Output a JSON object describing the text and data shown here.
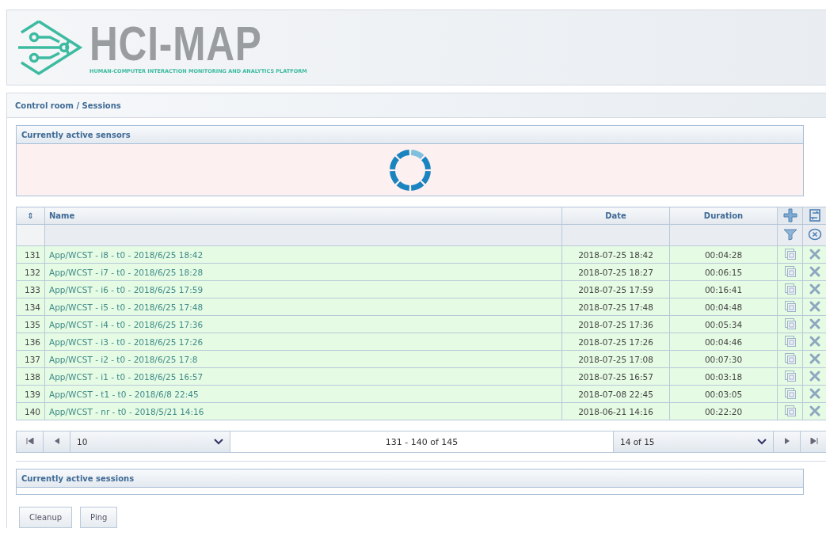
{
  "header": {
    "logo_title": "HCI-MAP",
    "logo_subtitle": "HUMAN-COMPUTER INTERACTION MONITORING AND ANALYTICS PLATFORM"
  },
  "breadcrumb": "Control room / Sessions",
  "sensors_panel": {
    "title": "Currently active sensors",
    "loading": true
  },
  "table": {
    "sort_icon": "⇕",
    "columns": [
      "Name",
      "Date",
      "Duration"
    ],
    "rows": [
      {
        "index": "131",
        "name": "App/WCST - i8 - t0 - 2018/6/25 18:42",
        "date": "2018-07-25 18:42",
        "duration": "00:04:28"
      },
      {
        "index": "132",
        "name": "App/WCST - i7 - t0 - 2018/6/25 18:28",
        "date": "2018-07-25 18:27",
        "duration": "00:06:15"
      },
      {
        "index": "133",
        "name": "App/WCST - i6 - t0 - 2018/6/25 17:59",
        "date": "2018-07-25 17:59",
        "duration": "00:16:41"
      },
      {
        "index": "134",
        "name": "App/WCST - i5 - t0 - 2018/6/25 17:48",
        "date": "2018-07-25 17:48",
        "duration": "00:04:48"
      },
      {
        "index": "135",
        "name": "App/WCST - i4 - t0 - 2018/6/25 17:36",
        "date": "2018-07-25 17:36",
        "duration": "00:05:34"
      },
      {
        "index": "136",
        "name": "App/WCST - i3 - t0 - 2018/6/25 17:26",
        "date": "2018-07-25 17:26",
        "duration": "00:04:46"
      },
      {
        "index": "137",
        "name": "App/WCST - i2 - t0 - 2018/6/25 17:8",
        "date": "2018-07-25 17:08",
        "duration": "00:07:30"
      },
      {
        "index": "138",
        "name": "App/WCST - i1 - t0 - 2018/6/25 16:57",
        "date": "2018-07-25 16:57",
        "duration": "00:03:18"
      },
      {
        "index": "139",
        "name": "App/WCST - t1 - t0 - 2018/6/8 22:45",
        "date": "2018-07-08 22:45",
        "duration": "00:03:05"
      },
      {
        "index": "140",
        "name": "App/WCST - nr - t0 - 2018/5/21 14:16",
        "date": "2018-06-21 14:16",
        "duration": "00:22:20"
      }
    ]
  },
  "pager": {
    "page_size": "10",
    "range": "131 - 140 of 145",
    "page": "14 of 15"
  },
  "sessions_panel": {
    "title": "Currently active sessions"
  },
  "buttons": [
    "Cleanup",
    "Ping"
  ]
}
